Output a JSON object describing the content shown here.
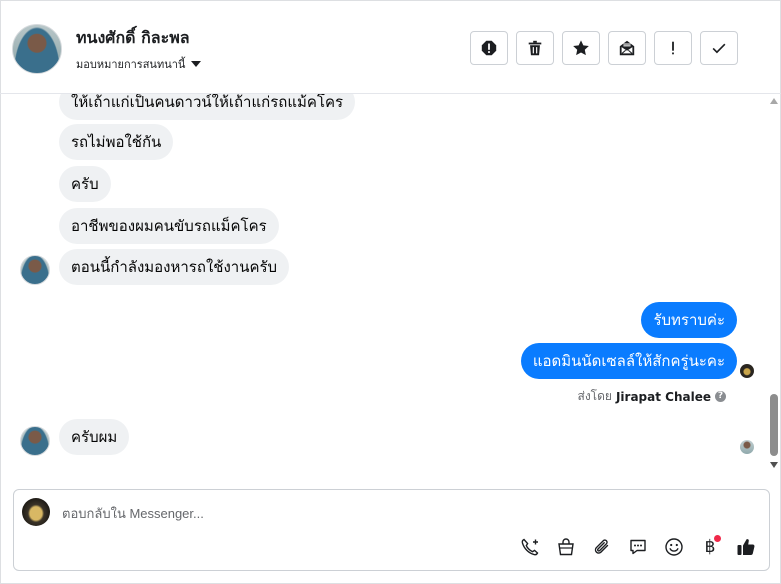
{
  "header": {
    "contact_name": "ทนงศักดิ์ กิละพล",
    "assign_label": "มอบหมายการสนทนานี้",
    "actions": [
      {
        "name": "mark-spam-icon",
        "tooltip": ""
      },
      {
        "name": "trash-icon",
        "tooltip": ""
      },
      {
        "name": "star-icon",
        "tooltip": ""
      },
      {
        "name": "mark-unread-icon",
        "tooltip": ""
      },
      {
        "name": "follow-up-icon",
        "tooltip": ""
      },
      {
        "name": "checkmark-icon",
        "tooltip": ""
      }
    ]
  },
  "messages": {
    "incoming": [
      "ให้เถ้าแก่เป็นคนดาวน์ให้เถ้าแก่รถแม้คโคร",
      "รถไม่พอใช้กัน",
      "ครับ",
      "อาชีพของผมคนขับรถแม็คโคร",
      "ตอนนี้กำลังมองหารถใช้งานครับ"
    ],
    "outgoing": [
      "รับทราบค่ะ",
      "แอดมินนัดเซลล์ให้สักครู่นะคะ"
    ],
    "sent_by_prefix": "ส่งโดย",
    "sent_by_name": "Jirapat Chalee",
    "help_glyph": "?",
    "last_incoming": "ครับผม"
  },
  "composer": {
    "placeholder": "ตอบกลับใน Messenger...",
    "tools": [
      "call-icon",
      "shopping-bag-icon",
      "paperclip-icon",
      "chat-bubble-icon",
      "emoji-icon",
      "baht-icon",
      "thumbs-up-icon"
    ],
    "baht_symbol": "฿"
  },
  "colors": {
    "outgoing_bubble": "#0a7cff",
    "incoming_bubble": "#eff1f3",
    "like_icon": "#1c1e21",
    "notification_dot": "#f02849"
  }
}
